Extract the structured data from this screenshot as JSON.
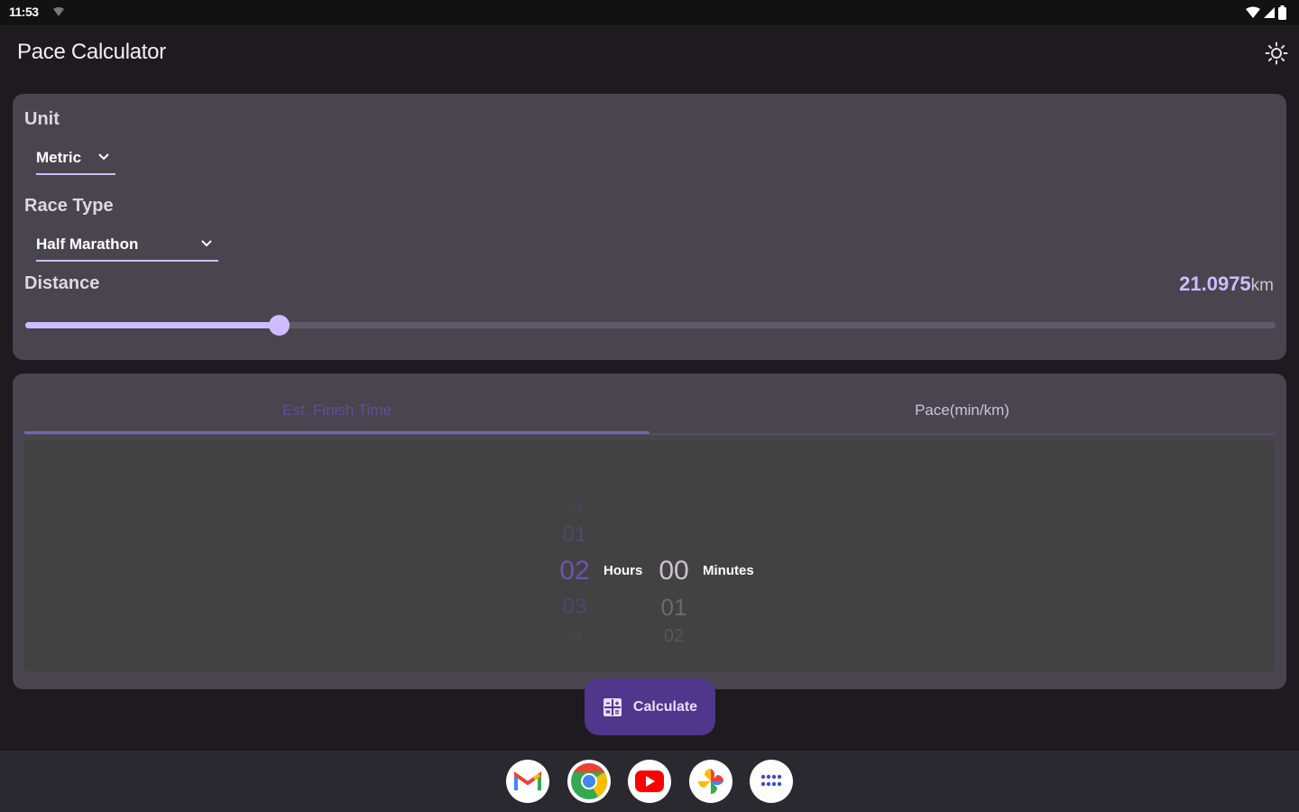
{
  "status_bar": {
    "time": "11:53"
  },
  "app": {
    "title": "Pace Calculator"
  },
  "unit": {
    "label": "Unit",
    "selected": "Metric"
  },
  "race_type": {
    "label": "Race Type",
    "selected": "Half Marathon"
  },
  "distance": {
    "label": "Distance",
    "value": "21.0975",
    "unit": "km",
    "slider_fraction": 0.203
  },
  "tabs": [
    {
      "label": "Est. Finish Time",
      "active": true
    },
    {
      "label": "Pace(min/km)",
      "active": false
    }
  ],
  "time_picker": {
    "hours": {
      "values": [
        "00",
        "01",
        "02",
        "03",
        "04"
      ],
      "selected": "02",
      "label": "Hours"
    },
    "minutes": {
      "values": [
        "00",
        "01",
        "02"
      ],
      "selected": "00",
      "label": "Minutes"
    }
  },
  "calculate_button": {
    "label": "Calculate"
  },
  "dock": {
    "apps": [
      "gmail-icon",
      "chrome-icon",
      "youtube-icon",
      "photos-icon",
      "app-drawer-icon"
    ]
  },
  "colors": {
    "accent": "#cfbcff",
    "card": "#48454e",
    "fab": "#4f378b",
    "tab_active": "#5f4f9a"
  }
}
